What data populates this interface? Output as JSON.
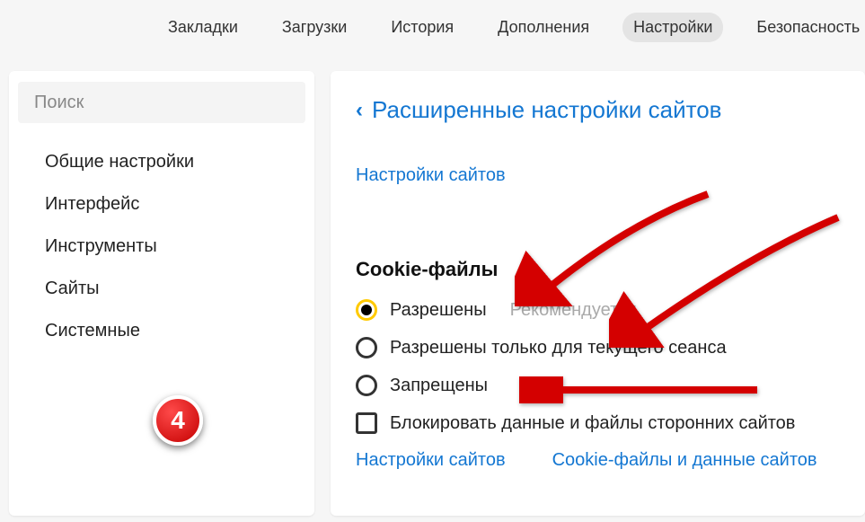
{
  "top_nav": {
    "items": [
      {
        "label": "Закладки"
      },
      {
        "label": "Загрузки"
      },
      {
        "label": "История"
      },
      {
        "label": "Дополнения"
      },
      {
        "label": "Настройки",
        "active": true
      },
      {
        "label": "Безопасность"
      }
    ]
  },
  "sidebar": {
    "search_placeholder": "Поиск",
    "items": [
      {
        "label": "Общие настройки"
      },
      {
        "label": "Интерфейс"
      },
      {
        "label": "Инструменты"
      },
      {
        "label": "Сайты"
      },
      {
        "label": "Системные"
      }
    ]
  },
  "content": {
    "breadcrumb_label": "Расширенные настройки сайтов",
    "link_site_settings": "Настройки сайтов",
    "section_heading": "Cookie-файлы",
    "options": {
      "allowed": "Разрешены",
      "allowed_hint": "Рекомендуется",
      "session_only": "Разрешены только для текущего сеанса",
      "blocked": "Запрещены",
      "block_thirdparty": "Блокировать данные и файлы сторонних сайтов"
    },
    "bottom_links": {
      "site_settings": "Настройки сайтов",
      "cookie_data": "Cookie-файлы и данные сайтов"
    }
  },
  "annotations": {
    "step_number": "4"
  }
}
